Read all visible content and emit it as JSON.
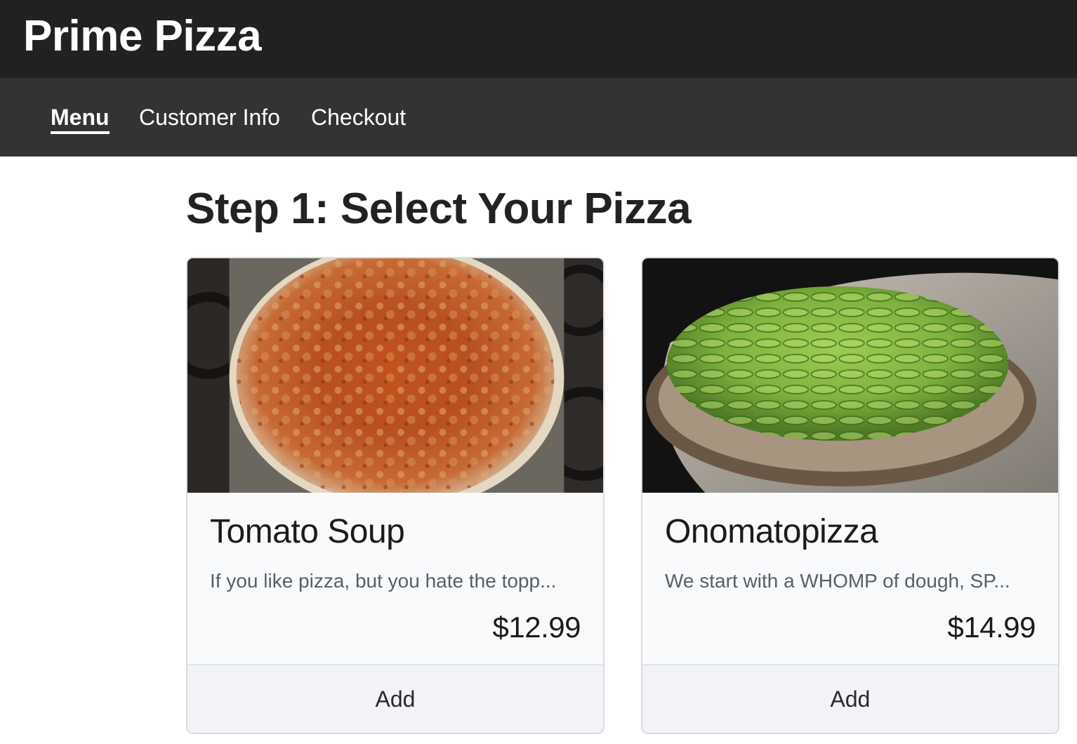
{
  "app": {
    "title": "Prime Pizza"
  },
  "nav": {
    "items": [
      {
        "label": "Menu",
        "active": true
      },
      {
        "label": "Customer Info",
        "active": false
      },
      {
        "label": "Checkout",
        "active": false
      }
    ]
  },
  "main": {
    "heading": "Step 1: Select Your Pizza",
    "pizzas": [
      {
        "name": "Tomato Soup",
        "description": "If you like pizza, but you hate the topp...",
        "price": "$12.99",
        "add_label": "Add",
        "image": "tomato-sauce-pizza-photo"
      },
      {
        "name": "Onomatopizza",
        "description": "We start with a WHOMP of dough, SP...",
        "price": "$14.99",
        "add_label": "Add",
        "image": "avocado-pizza-photo"
      }
    ]
  },
  "colors": {
    "header_bg": "#212121",
    "nav_bg": "#333333",
    "card_bg": "#f9fafc",
    "card_footer_bg": "#f1f3f6"
  }
}
